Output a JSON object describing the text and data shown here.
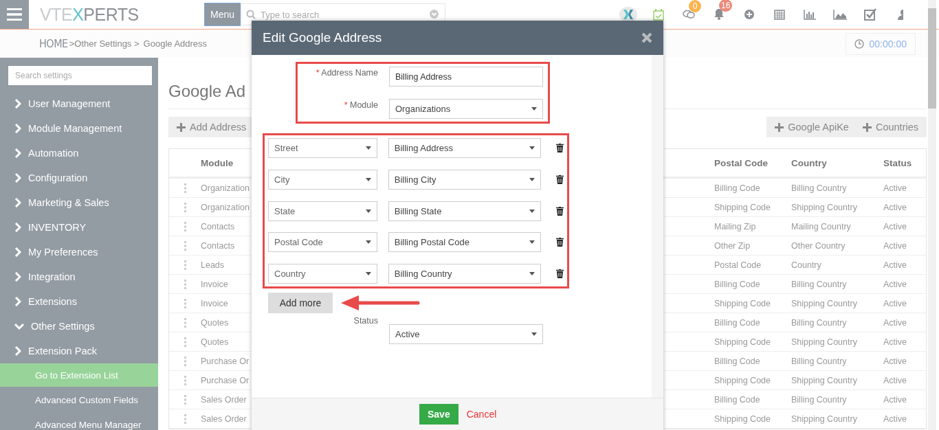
{
  "topbar": {
    "logo_parts": [
      {
        "text": "VTE",
        "color": "#c9cbcd"
      },
      {
        "text": "X",
        "color": "#5fc3c9"
      },
      {
        "text": "PERTS",
        "color": "#8d9195"
      }
    ],
    "menu_button": "Menu",
    "search": {
      "placeholder": "Type to search"
    },
    "icons": [
      {
        "kind": "xlogo"
      },
      {
        "kind": "calendar-check"
      },
      {
        "kind": "chat",
        "badge": "0",
        "color": "#fbb450"
      },
      {
        "kind": "bell",
        "badge": "16",
        "color": "#ea8a7a"
      },
      {
        "kind": "plus"
      },
      {
        "kind": "calendar"
      },
      {
        "kind": "bars"
      },
      {
        "kind": "area"
      },
      {
        "kind": "check"
      },
      {
        "kind": "user"
      }
    ]
  },
  "breadcrumb": {
    "home": "HOME",
    "items": [
      ">Other Settings >",
      "Google Address"
    ]
  },
  "timer": "00:00:00",
  "sidebar": {
    "search": {
      "placeholder": "Search settings"
    },
    "items": [
      {
        "label": "User Management",
        "expanded": false
      },
      {
        "label": "Module Management",
        "expanded": false
      },
      {
        "label": "Automation",
        "expanded": false
      },
      {
        "label": "Configuration",
        "expanded": false
      },
      {
        "label": "Marketing & Sales",
        "expanded": false
      },
      {
        "label": "INVENTORY",
        "expanded": false
      },
      {
        "label": "My Preferences",
        "expanded": false
      },
      {
        "label": "Integration",
        "expanded": false
      },
      {
        "label": "Extensions",
        "expanded": false
      },
      {
        "label": "Other Settings",
        "expanded": true
      },
      {
        "label": "Extension Pack",
        "expanded": false
      }
    ],
    "subitems": [
      {
        "label": "Go to Extension List",
        "selected": true
      },
      {
        "label": "Advanced Custom Fields",
        "selected": false
      },
      {
        "label": "Advanced Menu Manager",
        "selected": false
      }
    ]
  },
  "page_title": "Google Ad",
  "left_actions": [
    "Add Address"
  ],
  "right_actions": [
    "Google ApiKe",
    "Countries"
  ],
  "table": {
    "columns": [
      "Module",
      "Postal Code",
      "Country",
      "Status"
    ],
    "rows": [
      [
        "Organization",
        "Billing Code",
        "Billing Country",
        "Active"
      ],
      [
        "Organization",
        "Shipping Code",
        "Shipping Country",
        "Active"
      ],
      [
        "Contacts",
        "Mailing Zip",
        "Mailing Country",
        "Active"
      ],
      [
        "Contacts",
        "Other Zip",
        "Other Country",
        "Active"
      ],
      [
        "Leads",
        "Postal Code",
        "Country",
        "Active"
      ],
      [
        "Invoice",
        "Billing Code",
        "Billing Country",
        "Active"
      ],
      [
        "Invoice",
        "Shipping Code",
        "Shipping Country",
        "Active"
      ],
      [
        "Quotes",
        "Billing Code",
        "Billing Country",
        "Active"
      ],
      [
        "Quotes",
        "Shipping Code",
        "Shipping Country",
        "Active"
      ],
      [
        "Purchase Or",
        "Billing Code",
        "Billing Country",
        "Active"
      ],
      [
        "Purchase Or",
        "Shipping Code",
        "Shipping Country",
        "Active"
      ],
      [
        "Sales Order",
        "Billing Code",
        "Billing Country",
        "Active"
      ],
      [
        "Sales Order",
        "Shipping Code",
        "Shipping Country",
        "Active"
      ]
    ]
  },
  "modal": {
    "title": "Edit Google Address",
    "required_mark": "*",
    "fields": [
      {
        "label": "Address Name",
        "required": true,
        "kind": "text",
        "value": "Billing Address"
      },
      {
        "label": "Module",
        "required": true,
        "kind": "select",
        "value": "Organizations"
      }
    ],
    "mappings": [
      {
        "field": "Street",
        "source": "Billing Address"
      },
      {
        "field": "City",
        "source": "Billing City"
      },
      {
        "field": "State",
        "source": "Billing State"
      },
      {
        "field": "Postal Code",
        "source": "Billing Postal Code"
      },
      {
        "field": "Country",
        "source": "Billing Country"
      }
    ],
    "add_more": "Add more",
    "status": {
      "label": "Status",
      "value": "Active"
    },
    "save": "Save",
    "cancel": "Cancel"
  }
}
